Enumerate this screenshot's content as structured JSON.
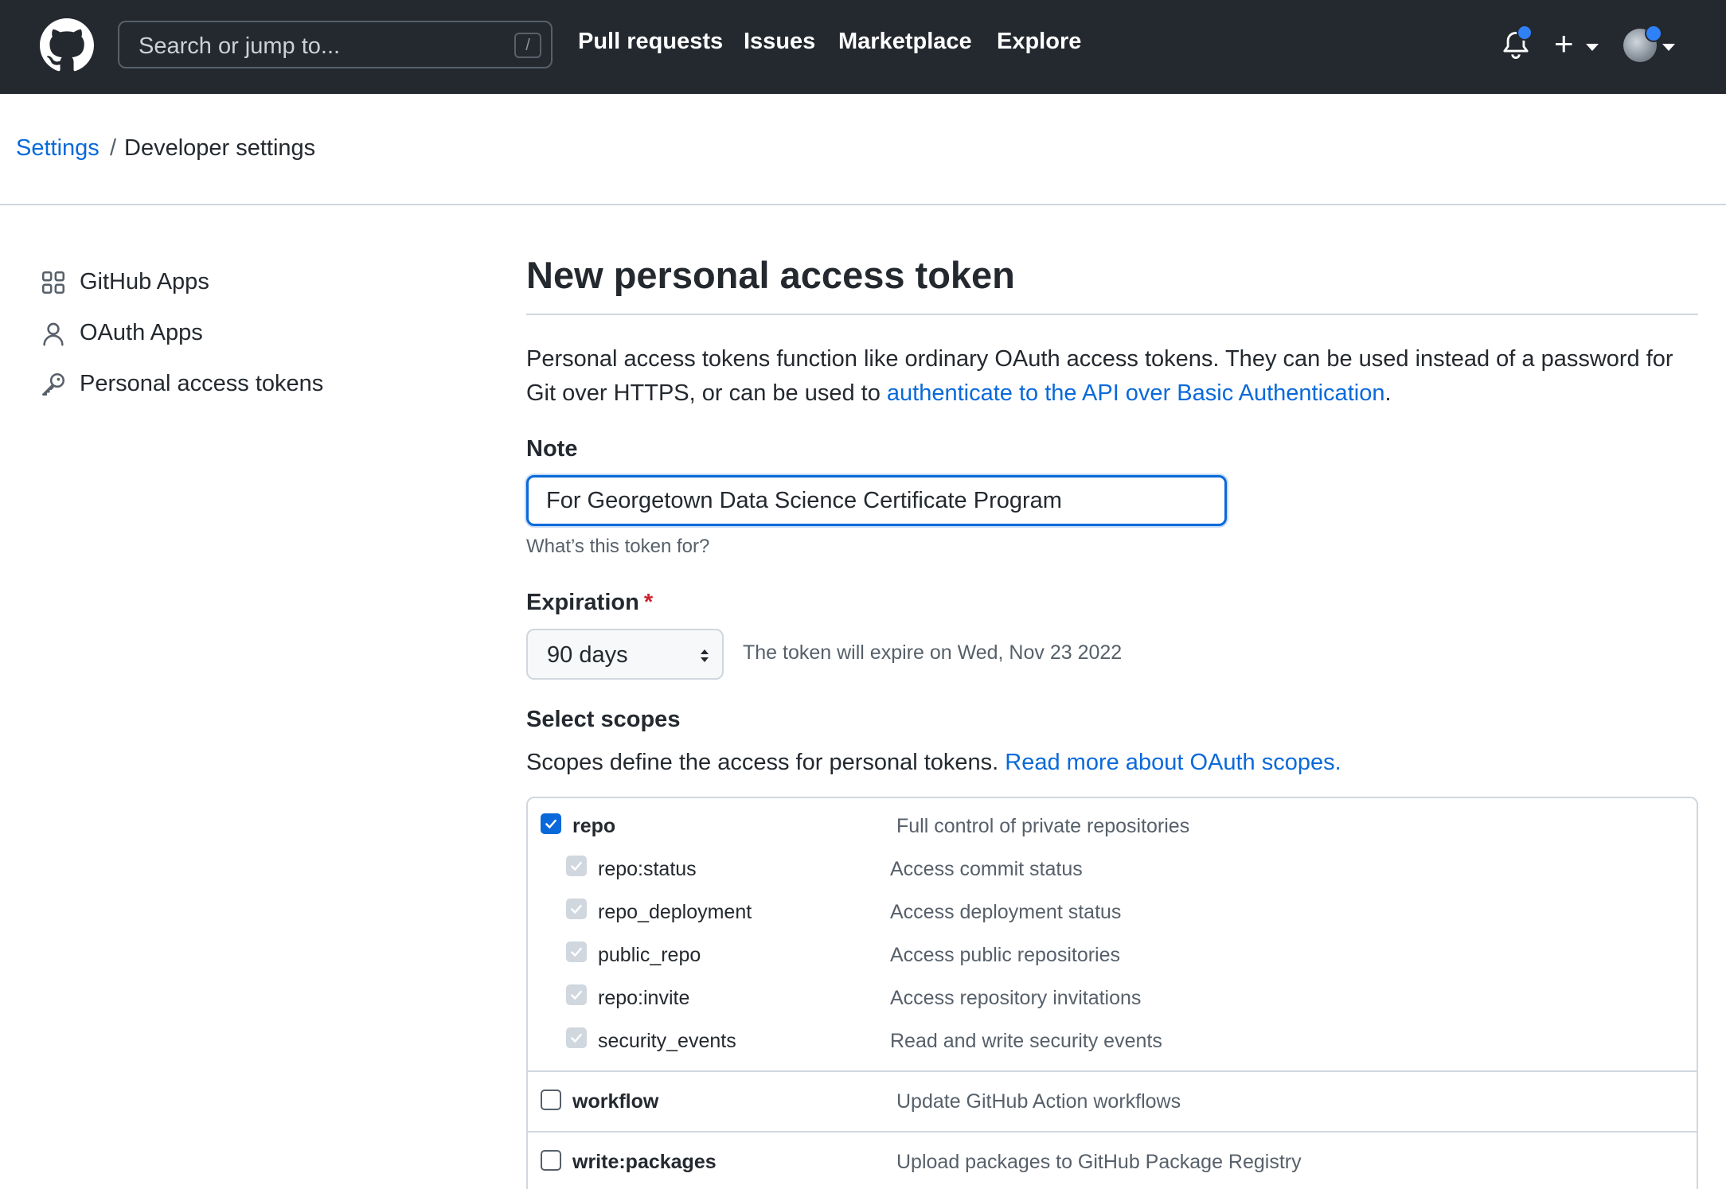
{
  "header": {
    "search_placeholder": "Search or jump to...",
    "search_shortcut": "/",
    "nav": [
      "Pull requests",
      "Issues",
      "Marketplace",
      "Explore"
    ],
    "plus_label": "+"
  },
  "breadcrumb": {
    "parent": "Settings",
    "separator": "/",
    "current": "Developer settings"
  },
  "sidebar": {
    "items": [
      {
        "label": "GitHub Apps",
        "icon": "apps-grid-icon"
      },
      {
        "label": "OAuth Apps",
        "icon": "person-icon"
      },
      {
        "label": "Personal access tokens",
        "icon": "key-icon"
      }
    ]
  },
  "main": {
    "title": "New personal access token",
    "intro_text": "Personal access tokens function like ordinary OAuth access tokens. They can be used instead of a password for Git over HTTPS, or can be used to ",
    "intro_link": "authenticate to the API over Basic Authentication",
    "intro_end": ".",
    "note": {
      "label": "Note",
      "value": "For Georgetown Data Science Certificate Program",
      "hint": "What’s this token for?"
    },
    "expiration": {
      "label": "Expiration",
      "required_mark": "*",
      "selected": "90 days",
      "note": "The token will expire on Wed, Nov 23 2022"
    },
    "scopes": {
      "heading": "Select scopes",
      "desc": "Scopes define the access for personal tokens. ",
      "desc_link": "Read more about OAuth scopes.",
      "groups": [
        {
          "name": "repo",
          "desc": "Full control of private repositories",
          "checked": true,
          "children": [
            {
              "name": "repo:status",
              "desc": "Access commit status"
            },
            {
              "name": "repo_deployment",
              "desc": "Access deployment status"
            },
            {
              "name": "public_repo",
              "desc": "Access public repositories"
            },
            {
              "name": "repo:invite",
              "desc": "Access repository invitations"
            },
            {
              "name": "security_events",
              "desc": "Read and write security events"
            }
          ]
        },
        {
          "name": "workflow",
          "desc": "Update GitHub Action workflows",
          "checked": false
        },
        {
          "name": "write:packages",
          "desc": "Upload packages to GitHub Package Registry",
          "checked": false
        }
      ]
    }
  },
  "colors": {
    "header_bg": "#24292f",
    "link": "#0969da",
    "required": "#cf222e",
    "notification_dot": "#2f81f7"
  }
}
